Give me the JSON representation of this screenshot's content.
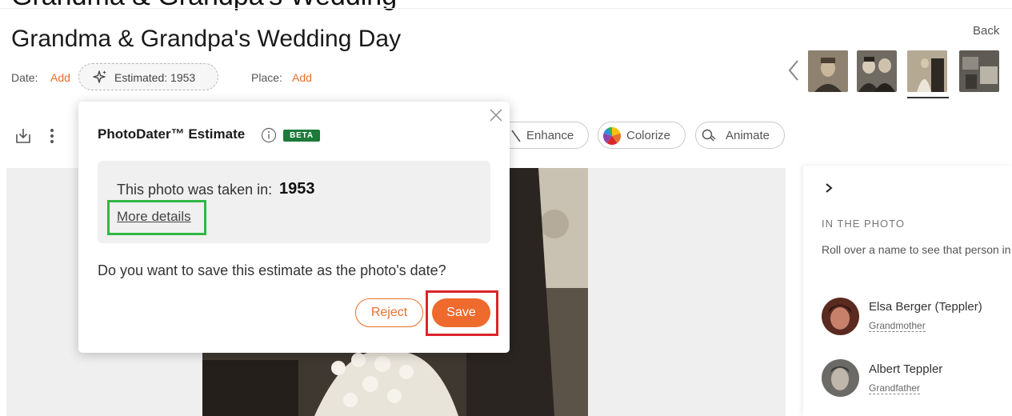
{
  "header": {
    "title": "Grandma & Grandpa's Wedding Day",
    "back_label": "Back"
  },
  "meta": {
    "date_label": "Date:",
    "date_add": "Add",
    "estimate_chip": "Estimated: 1953",
    "place_label": "Place:",
    "place_add": "Add"
  },
  "toolbar": {
    "enhance": "Enhance",
    "colorize": "Colorize",
    "animate": "Animate"
  },
  "popover": {
    "title": "PhotoDater™ Estimate",
    "beta": "BETA",
    "taken_label": "This photo was taken in:",
    "taken_year": "1953",
    "more_details": "More details",
    "question": "Do you want to save this estimate as the photo's date?",
    "reject": "Reject",
    "save": "Save"
  },
  "side_panel": {
    "section_heading": "IN THE PHOTO",
    "section_desc": "Roll over a name to see that person in the photo",
    "people": [
      {
        "name": "Elsa Berger (Teppler)",
        "relation": "Grandmother"
      },
      {
        "name": "Albert Teppler",
        "relation": "Grandfather"
      }
    ]
  },
  "colors": {
    "accent": "#ee6a2d",
    "link": "#e8702a",
    "beta_badge": "#1d7a3a",
    "highlight_green": "#2fb845",
    "highlight_red": "#d9262c"
  },
  "icons": [
    "download-icon",
    "more-vert-icon",
    "sparkle-icon",
    "info-icon",
    "close-icon",
    "wand-icon",
    "color-wheel-icon",
    "animate-icon",
    "chevron-left-icon",
    "chevron-right-icon"
  ]
}
